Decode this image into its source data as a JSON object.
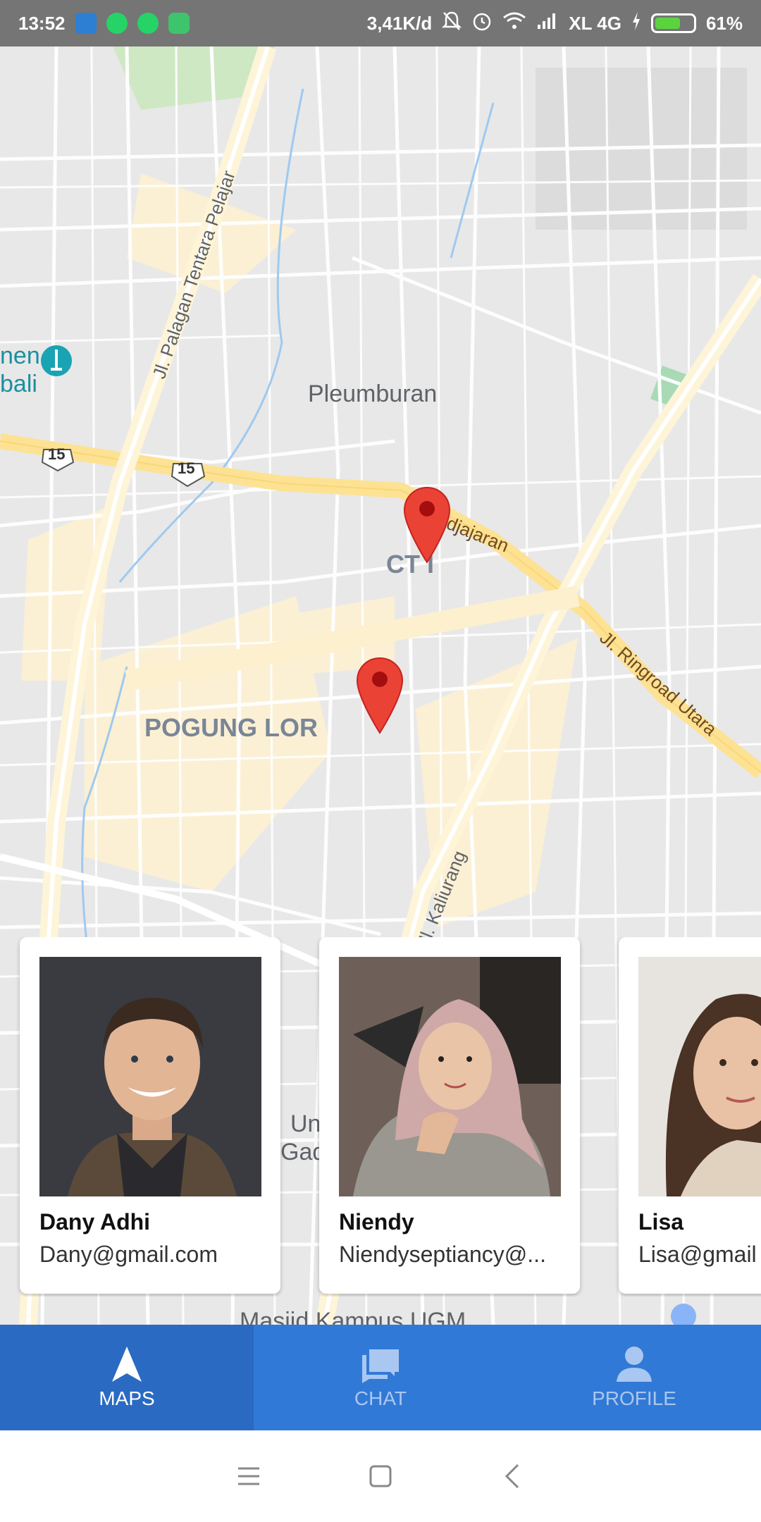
{
  "status_bar": {
    "time": "13:52",
    "network_speed": "3,41K/d",
    "carrier": "XL 4G",
    "battery": "61%",
    "battery_level": 0.61,
    "icons": [
      "shield-icon",
      "whatsapp-icon",
      "whatsapp-icon",
      "android-icon",
      "mute-bell-icon",
      "alarm-icon",
      "wifi-icon",
      "signal-icon",
      "charging-icon",
      "battery-icon"
    ]
  },
  "map": {
    "place_labels": {
      "pleumburan": "Pleumburan",
      "pogung_lor": "POGUNG LOR",
      "cti": "CT I",
      "monumen_line1": "nen",
      "monumen_line2": "bali",
      "university_line1": "Un",
      "university_line2": "Gad",
      "masjid": "Masjid Kampus UGM"
    },
    "road_labels": {
      "palagan": "Jl. Palagan Tentara Pelajar",
      "ringroad": "Jl. Ringroad Utara",
      "padjajaran": "djajaran",
      "kaliurang": "Jl. Kaliurang"
    },
    "route_shields": [
      "15",
      "15"
    ],
    "markers": [
      "location-pin",
      "location-pin"
    ],
    "colors": {
      "road_major": "#fde293",
      "road_minor": "#ffffff",
      "marker": "#ea4335",
      "park": "#a8dab5",
      "water": "#9fc9f0"
    }
  },
  "profiles": [
    {
      "name": "Dany Adhi",
      "email": "Dany@gmail.com"
    },
    {
      "name": "Niendy",
      "email": "Niendyseptiancy@..."
    },
    {
      "name": "Lisa",
      "email": "Lisa@gmail"
    }
  ],
  "bottom_nav": {
    "items": [
      {
        "label": "MAPS",
        "icon": "navigation-arrow-icon",
        "active": true
      },
      {
        "label": "CHAT",
        "icon": "chat-icon",
        "active": false
      },
      {
        "label": "PROFILE",
        "icon": "person-icon",
        "active": false
      }
    ],
    "colors": {
      "bar": "#3179d6",
      "active": "#2a6ac2"
    }
  },
  "system_nav": {
    "icons": [
      "menu-icon",
      "home-square-icon",
      "back-icon"
    ]
  }
}
